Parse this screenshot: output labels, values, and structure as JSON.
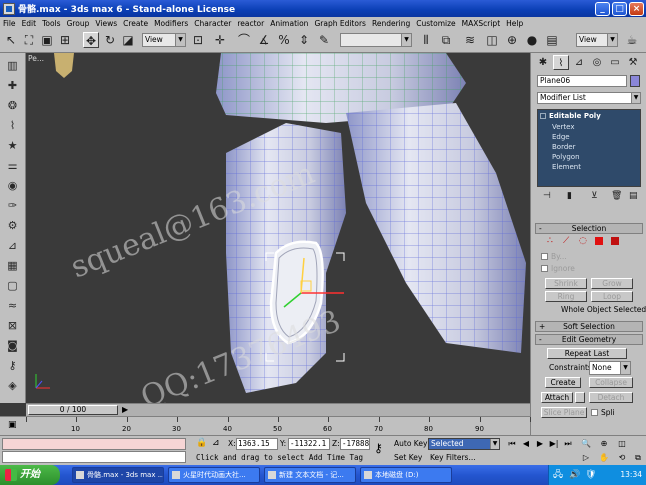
{
  "window": {
    "title": "骨骼.max - 3ds max 6 - Stand-alone License",
    "buttons": [
      "minimize",
      "maximize",
      "close"
    ]
  },
  "menu": [
    "File",
    "Edit",
    "Tools",
    "Group",
    "Views",
    "Create",
    "Modifiers",
    "Character",
    "reactor",
    "Animation",
    "Graph Editors",
    "Rendering",
    "Customize",
    "MAXScript",
    "Help"
  ],
  "toolbar": {
    "view_dropdown_1": "View",
    "view_dropdown_2": "View",
    "named_selection": ""
  },
  "viewport": {
    "label_partial": "Pe...",
    "watermark_1": "squeal@163.com",
    "watermark_2": "QQ:17376493"
  },
  "command_panel": {
    "object_name": "Plane06",
    "object_color": "#8a86d8",
    "modifier_list": "Modifier List",
    "stack_top": "Editable Poly",
    "stack_items": [
      "Vertex",
      "Edge",
      "Border",
      "Polygon",
      "Element"
    ],
    "selection_rollout": "Selection",
    "by_vertex": "By...",
    "ignore": "Ignore",
    "shrink": "Shrink",
    "grow": "Grow",
    "ring": "Ring",
    "loop": "Loop",
    "whole_object": "Whole Object Selected",
    "soft_selection_rollout": "Soft Selection",
    "edit_geometry_rollout": "Edit Geometry",
    "repeat_last": "Repeat Last",
    "constraints_label": "Constraints:",
    "constraints_value": "None",
    "create": "Create",
    "collapse": "Collapse",
    "attach": "Attach",
    "detach": "Detach",
    "slice_plane": "Slice Plane",
    "split": "Spli"
  },
  "timeline": {
    "frame_readout": "0 / 100",
    "ticks": [
      "10",
      "20",
      "30",
      "40",
      "50",
      "60",
      "70",
      "80",
      "90"
    ]
  },
  "status": {
    "x_label": "X:",
    "x_value": "1363.15",
    "y_label": "Y:",
    "y_value": "-11322.1",
    "z_label": "Z:",
    "z_value": "-17888.",
    "auto_key": "Auto Key",
    "selected": "Selected",
    "set_key": "Set Key",
    "key_filters": "Key Filters...",
    "prompt": "Click and drag to select",
    "add_time_tag": "Add Time Tag"
  },
  "taskbar": {
    "start": "开始",
    "tasks": [
      "骨骼.max - 3ds max ...",
      "火星时代动画大社...",
      "新建 文本文档 - 记...",
      "本地磁盘 (D:)"
    ],
    "clock": "13:34"
  }
}
